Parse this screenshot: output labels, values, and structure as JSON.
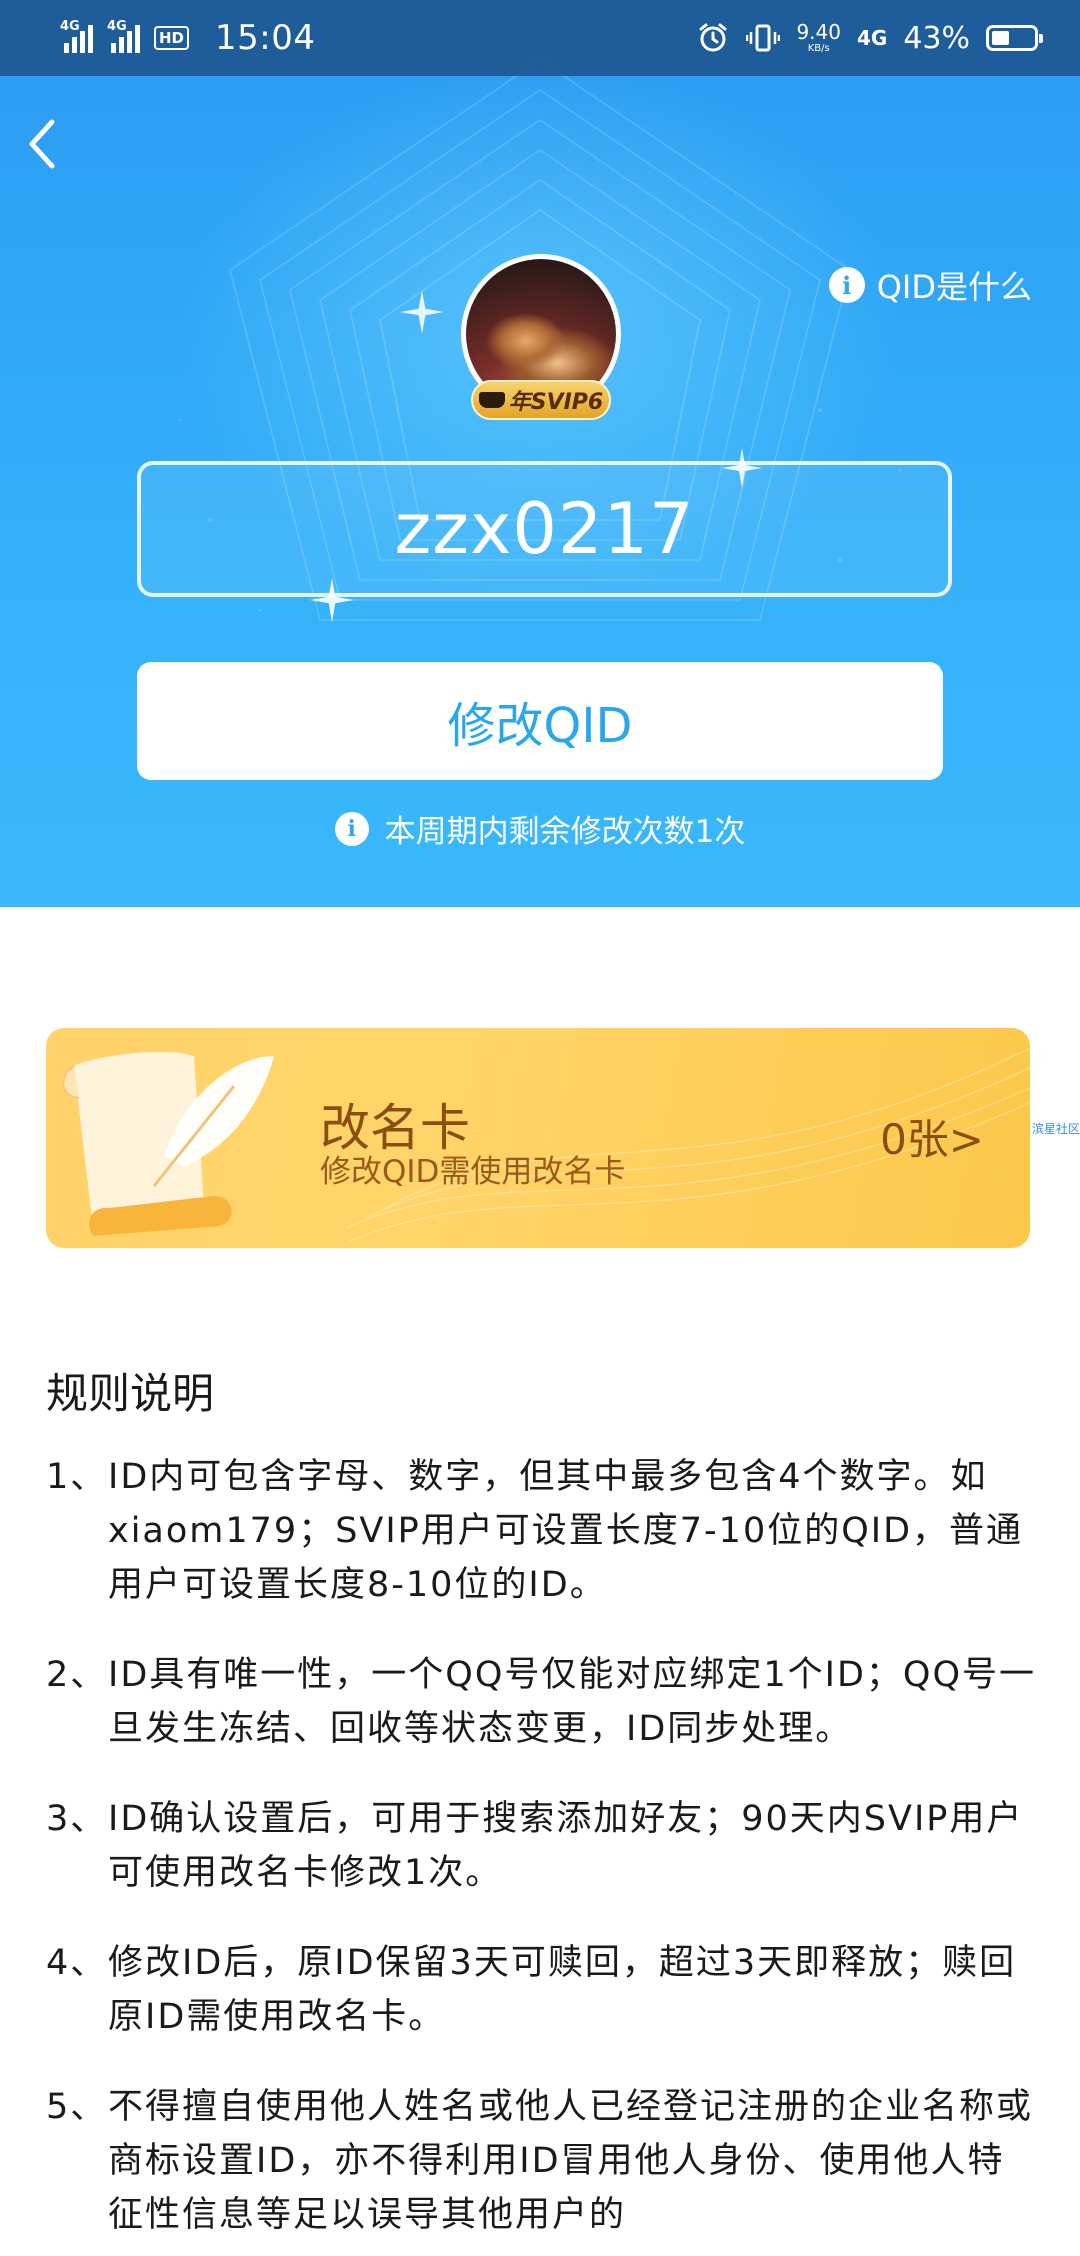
{
  "status_bar": {
    "signal1": "4G",
    "signal2": "4G",
    "hd": "HD",
    "time": "15:04",
    "net_speed": "9.40",
    "net_unit": "KB/s",
    "net_type": "4G",
    "battery_pct": "43%",
    "battery_level": 0.43
  },
  "header": {
    "help_label": "QID是什么"
  },
  "profile": {
    "badge": "年SVIP6",
    "qid": "zzx0217"
  },
  "actions": {
    "modify_label": "修改QID",
    "remaining_note": "本周期内剩余修改次数1次"
  },
  "rename_card": {
    "title": "改名卡",
    "subtitle": "修改QID需使用改名卡",
    "count": "0张>"
  },
  "watermark": "滨星社区",
  "rules": {
    "title": "规则说明",
    "items": [
      {
        "num": "1、",
        "text": "ID内可包含字母、数字，但其中最多包含4个数字。如xiaom179；SVIP用户可设置长度7-10位的QID，普通用户可设置长度8-10位的ID。"
      },
      {
        "num": "2、",
        "text": "ID具有唯一性，一个QQ号仅能对应绑定1个ID；QQ号一旦发生冻结、回收等状态变更，ID同步处理。"
      },
      {
        "num": "3、",
        "text": "ID确认设置后，可用于搜索添加好友；90天内SVIP用户可使用改名卡修改1次。"
      },
      {
        "num": "4、",
        "text": "修改ID后，原ID保留3天可赎回，超过3天即释放；赎回原ID需使用改名卡。"
      },
      {
        "num": "5、",
        "text": "不得擅自使用他人姓名或他人已经登记注册的企业名称或商标设置ID，亦不得利用ID冒用他人身份、使用他人特征性信息等足以误导其他用户的"
      }
    ]
  },
  "colors": {
    "hero_blue": "#36b3fb",
    "accent_blue": "#2aa7ec",
    "card_gold": "#ffd36a",
    "card_text": "#8a4e10"
  },
  "icons": [
    "back-arrow-icon",
    "info-icon",
    "alarm-icon",
    "vibrate-icon",
    "battery-icon"
  ]
}
